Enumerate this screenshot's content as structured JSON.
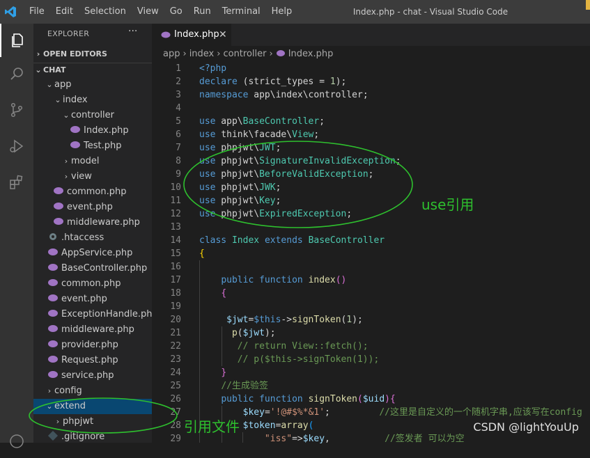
{
  "window": {
    "title": "Index.php - chat - Visual Studio Code",
    "menu": [
      "File",
      "Edit",
      "Selection",
      "View",
      "Go",
      "Run",
      "Terminal",
      "Help"
    ]
  },
  "activity_bar": {
    "items": [
      "explorer-icon",
      "search-icon",
      "source-control-icon",
      "run-debug-icon",
      "extensions-icon",
      "accounts-icon"
    ]
  },
  "sidebar": {
    "title": "EXPLORER",
    "more": "···",
    "open_editors": "OPEN EDITORS",
    "project": "CHAT",
    "tree": [
      {
        "label": "app",
        "type": "folder-open"
      },
      {
        "label": "index",
        "type": "folder-open"
      },
      {
        "label": "controller",
        "type": "folder-open"
      },
      {
        "label": "Index.php",
        "type": "php"
      },
      {
        "label": "Test.php",
        "type": "php"
      },
      {
        "label": "model",
        "type": "folder"
      },
      {
        "label": "view",
        "type": "folder"
      },
      {
        "label": "common.php",
        "type": "php"
      },
      {
        "label": "event.php",
        "type": "php"
      },
      {
        "label": "middleware.php",
        "type": "php"
      },
      {
        "label": ".htaccess",
        "type": "config"
      },
      {
        "label": "AppService.php",
        "type": "php"
      },
      {
        "label": "BaseController.php",
        "type": "php"
      },
      {
        "label": "common.php",
        "type": "php"
      },
      {
        "label": "event.php",
        "type": "php"
      },
      {
        "label": "ExceptionHandle.php",
        "type": "php"
      },
      {
        "label": "middleware.php",
        "type": "php"
      },
      {
        "label": "provider.php",
        "type": "php"
      },
      {
        "label": "Request.php",
        "type": "php"
      },
      {
        "label": "service.php",
        "type": "php"
      },
      {
        "label": "config",
        "type": "folder"
      },
      {
        "label": "extend",
        "type": "folder-open"
      },
      {
        "label": "phpjwt",
        "type": "folder"
      },
      {
        "label": ".gitignore",
        "type": "git"
      }
    ]
  },
  "editor": {
    "tab": {
      "label": "Index.php",
      "close": "✕"
    },
    "breadcrumb": [
      "app",
      "index",
      "controller",
      "Index.php"
    ],
    "lines": [
      {
        "n": "1",
        "tokens": [
          {
            "t": "<?php",
            "c": "#569cd6"
          }
        ]
      },
      {
        "n": "2",
        "tokens": [
          {
            "t": "declare",
            "c": "#569cd6"
          },
          {
            "t": " (",
            "c": "#d4d4d4"
          },
          {
            "t": "strict_types",
            "c": "#d4d4d4"
          },
          {
            "t": " = ",
            "c": "#d4d4d4"
          },
          {
            "t": "1",
            "c": "#b5cea8"
          },
          {
            "t": ");",
            "c": "#d4d4d4"
          }
        ]
      },
      {
        "n": "3",
        "tokens": [
          {
            "t": "namespace",
            "c": "#569cd6"
          },
          {
            "t": " app\\index\\controller;",
            "c": "#d4d4d4"
          }
        ]
      },
      {
        "n": "4",
        "tokens": []
      },
      {
        "n": "5",
        "tokens": [
          {
            "t": "use",
            "c": "#569cd6"
          },
          {
            "t": " app\\",
            "c": "#d4d4d4"
          },
          {
            "t": "BaseController",
            "c": "#4ec9b0"
          },
          {
            "t": ";",
            "c": "#d4d4d4"
          }
        ]
      },
      {
        "n": "6",
        "tokens": [
          {
            "t": "use",
            "c": "#569cd6"
          },
          {
            "t": " think\\facade\\",
            "c": "#d4d4d4"
          },
          {
            "t": "View",
            "c": "#4ec9b0"
          },
          {
            "t": ";",
            "c": "#d4d4d4"
          }
        ]
      },
      {
        "n": "7",
        "tokens": [
          {
            "t": "use",
            "c": "#569cd6"
          },
          {
            "t": " phpjwt\\",
            "c": "#d4d4d4"
          },
          {
            "t": "JWT",
            "c": "#4ec9b0"
          },
          {
            "t": ";",
            "c": "#d4d4d4"
          }
        ]
      },
      {
        "n": "8",
        "tokens": [
          {
            "t": "use",
            "c": "#569cd6"
          },
          {
            "t": " phpjwt\\",
            "c": "#d4d4d4"
          },
          {
            "t": "SignatureInvalidException",
            "c": "#4ec9b0"
          },
          {
            "t": ";",
            "c": "#d4d4d4"
          }
        ]
      },
      {
        "n": "9",
        "tokens": [
          {
            "t": "use",
            "c": "#569cd6"
          },
          {
            "t": " phpjwt\\",
            "c": "#d4d4d4"
          },
          {
            "t": "BeforeValidException",
            "c": "#4ec9b0"
          },
          {
            "t": ";",
            "c": "#d4d4d4"
          }
        ]
      },
      {
        "n": "10",
        "tokens": [
          {
            "t": "use",
            "c": "#569cd6"
          },
          {
            "t": " phpjwt\\",
            "c": "#d4d4d4"
          },
          {
            "t": "JWK",
            "c": "#4ec9b0"
          },
          {
            "t": ";",
            "c": "#d4d4d4"
          }
        ]
      },
      {
        "n": "11",
        "tokens": [
          {
            "t": "use",
            "c": "#569cd6"
          },
          {
            "t": " phpjwt\\",
            "c": "#d4d4d4"
          },
          {
            "t": "Key",
            "c": "#4ec9b0"
          },
          {
            "t": ";",
            "c": "#d4d4d4"
          }
        ]
      },
      {
        "n": "12",
        "tokens": [
          {
            "t": "use",
            "c": "#569cd6"
          },
          {
            "t": " phpjwt\\",
            "c": "#d4d4d4"
          },
          {
            "t": "ExpiredException",
            "c": "#4ec9b0"
          },
          {
            "t": ";",
            "c": "#d4d4d4"
          }
        ]
      },
      {
        "n": "13",
        "tokens": []
      },
      {
        "n": "14",
        "tokens": [
          {
            "t": "class",
            "c": "#569cd6"
          },
          {
            "t": " ",
            "c": "#d4d4d4"
          },
          {
            "t": "Index",
            "c": "#4ec9b0"
          },
          {
            "t": " ",
            "c": "#d4d4d4"
          },
          {
            "t": "extends",
            "c": "#569cd6"
          },
          {
            "t": " ",
            "c": "#d4d4d4"
          },
          {
            "t": "BaseController",
            "c": "#4ec9b0"
          }
        ]
      },
      {
        "n": "15",
        "tokens": [
          {
            "t": "{",
            "c": "#ffd700"
          }
        ]
      },
      {
        "n": "16",
        "tokens": []
      },
      {
        "n": "17",
        "tokens": [
          {
            "t": "    ",
            "c": "#d4d4d4"
          },
          {
            "t": "public",
            "c": "#569cd6"
          },
          {
            "t": " ",
            "c": "#d4d4d4"
          },
          {
            "t": "function",
            "c": "#569cd6"
          },
          {
            "t": " ",
            "c": "#d4d4d4"
          },
          {
            "t": "index",
            "c": "#dcdcaa"
          },
          {
            "t": "()",
            "c": "#da70d6"
          }
        ]
      },
      {
        "n": "18",
        "tokens": [
          {
            "t": "    ",
            "c": "#d4d4d4"
          },
          {
            "t": "{",
            "c": "#da70d6"
          }
        ]
      },
      {
        "n": "19",
        "tokens": []
      },
      {
        "n": "20",
        "tokens": [
          {
            "t": "     ",
            "c": "#d4d4d4"
          },
          {
            "t": "$jwt",
            "c": "#9cdcfe"
          },
          {
            "t": "=",
            "c": "#d4d4d4"
          },
          {
            "t": "$this",
            "c": "#569cd6"
          },
          {
            "t": "->",
            "c": "#d4d4d4"
          },
          {
            "t": "signToken",
            "c": "#dcdcaa"
          },
          {
            "t": "(",
            "c": "#d4d4d4"
          },
          {
            "t": "1",
            "c": "#b5cea8"
          },
          {
            "t": ");",
            "c": "#d4d4d4"
          }
        ]
      },
      {
        "n": "21",
        "tokens": [
          {
            "t": "      ",
            "c": "#d4d4d4"
          },
          {
            "t": "p",
            "c": "#dcdcaa"
          },
          {
            "t": "(",
            "c": "#d4d4d4"
          },
          {
            "t": "$jwt",
            "c": "#9cdcfe"
          },
          {
            "t": ");",
            "c": "#d4d4d4"
          }
        ]
      },
      {
        "n": "22",
        "tokens": [
          {
            "t": "       ",
            "c": "#d4d4d4"
          },
          {
            "t": "// return View::fetch();",
            "c": "#6a9955"
          }
        ]
      },
      {
        "n": "23",
        "tokens": [
          {
            "t": "       ",
            "c": "#d4d4d4"
          },
          {
            "t": "// p($this->signToken(1));",
            "c": "#6a9955"
          }
        ]
      },
      {
        "n": "24",
        "tokens": [
          {
            "t": "    ",
            "c": "#d4d4d4"
          },
          {
            "t": "}",
            "c": "#da70d6"
          }
        ]
      },
      {
        "n": "25",
        "tokens": [
          {
            "t": "    ",
            "c": "#d4d4d4"
          },
          {
            "t": "//生成验签",
            "c": "#6a9955"
          }
        ]
      },
      {
        "n": "26",
        "tokens": [
          {
            "t": "    ",
            "c": "#d4d4d4"
          },
          {
            "t": "public",
            "c": "#569cd6"
          },
          {
            "t": " ",
            "c": "#d4d4d4"
          },
          {
            "t": "function",
            "c": "#569cd6"
          },
          {
            "t": " ",
            "c": "#d4d4d4"
          },
          {
            "t": "signToken",
            "c": "#dcdcaa"
          },
          {
            "t": "(",
            "c": "#da70d6"
          },
          {
            "t": "$uid",
            "c": "#9cdcfe"
          },
          {
            "t": "){",
            "c": "#da70d6"
          }
        ]
      },
      {
        "n": "27",
        "tokens": [
          {
            "t": "        ",
            "c": "#d4d4d4"
          },
          {
            "t": "$key",
            "c": "#9cdcfe"
          },
          {
            "t": "=",
            "c": "#d4d4d4"
          },
          {
            "t": "'!@#$%*&1'",
            "c": "#ce9178"
          },
          {
            "t": ";",
            "c": "#d4d4d4"
          },
          {
            "t": "         ",
            "c": "#d4d4d4"
          },
          {
            "t": "//这里是自定义的一个随机字串,应该写在config",
            "c": "#6a9955"
          }
        ]
      },
      {
        "n": "28",
        "tokens": [
          {
            "t": "        ",
            "c": "#d4d4d4"
          },
          {
            "t": "$token",
            "c": "#9cdcfe"
          },
          {
            "t": "=",
            "c": "#d4d4d4"
          },
          {
            "t": "array",
            "c": "#dcdcaa"
          },
          {
            "t": "(",
            "c": "#179fff"
          }
        ]
      },
      {
        "n": "29",
        "tokens": [
          {
            "t": "            ",
            "c": "#d4d4d4"
          },
          {
            "t": "\"iss\"",
            "c": "#ce9178"
          },
          {
            "t": "=>",
            "c": "#d4d4d4"
          },
          {
            "t": "$key",
            "c": "#9cdcfe"
          },
          {
            "t": ",",
            "c": "#d4d4d4"
          },
          {
            "t": "          ",
            "c": "#d4d4d4"
          },
          {
            "t": "//签发者 可以为空",
            "c": "#6a9955"
          }
        ]
      }
    ]
  },
  "annotations": {
    "use_label": "use引用",
    "file_label": "引用文件",
    "color": "#2ec02e"
  },
  "watermark": "CSDN @lightYouUp"
}
